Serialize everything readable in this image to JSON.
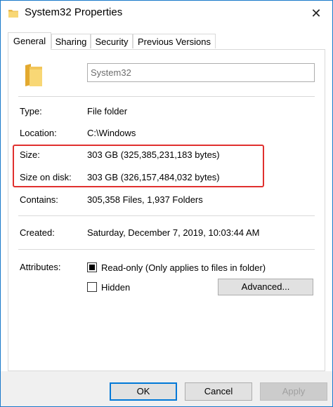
{
  "window": {
    "title": "System32 Properties",
    "close_glyph": "✕",
    "icon": "folder-icon",
    "border_color": "#1979ca"
  },
  "tabs": [
    {
      "label": "General",
      "active": true
    },
    {
      "label": "Sharing",
      "active": false
    },
    {
      "label": "Security",
      "active": false
    },
    {
      "label": "Previous Versions",
      "active": false
    }
  ],
  "general": {
    "folder_name": "System32",
    "type": {
      "label": "Type:",
      "value": "File folder"
    },
    "location": {
      "label": "Location:",
      "value": "C:\\Windows"
    },
    "size": {
      "label": "Size:",
      "value": "303 GB (325,385,231,183 bytes)"
    },
    "size_on_disk": {
      "label": "Size on disk:",
      "value": "303 GB (326,157,484,032 bytes)"
    },
    "contains": {
      "label": "Contains:",
      "value": "305,358 Files, 1,937 Folders"
    },
    "created": {
      "label": "Created:",
      "value": "Saturday, December 7, 2019, 10:03:44 AM"
    },
    "attributes": {
      "label": "Attributes:",
      "readonly": {
        "label": "Read-only (Only applies to files in folder)",
        "checked": true
      },
      "hidden": {
        "label": "Hidden",
        "checked": false
      },
      "advanced_label": "Advanced..."
    },
    "highlight_color": "#e0302e"
  },
  "buttons": {
    "ok": "OK",
    "cancel": "Cancel",
    "apply": "Apply",
    "apply_enabled": false
  }
}
